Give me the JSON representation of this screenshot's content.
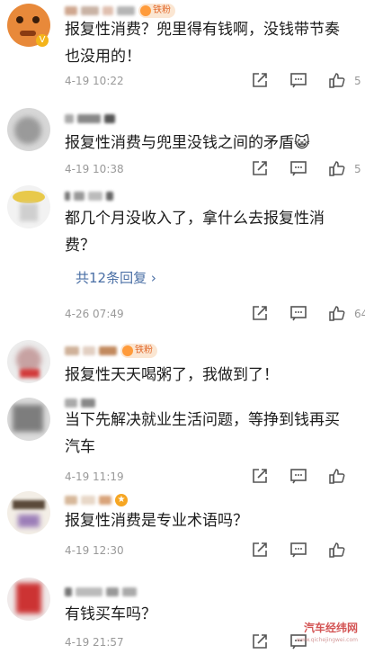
{
  "comments": [
    {
      "text": "报复性消费？兜里得有钱啊，没钱带节奏也没用的！",
      "time": "4-19 10:22",
      "likes": "5",
      "badge": "铁粉"
    },
    {
      "text": "报复性消费与兜里没钱之间的矛盾😺",
      "time": "4-19 10:38",
      "likes": "5"
    },
    {
      "text": "都几个月没收入了，拿什么去报复性消费？",
      "time": "4-26 07:49",
      "likes": "64",
      "replies": "共12条回复 ›"
    },
    {
      "text": "报复性天天喝粥了，我做到了！",
      "badge": "铁粉"
    },
    {
      "text": "当下先解决就业生活问题，等挣到钱再买汽车",
      "time": "4-19 11:19"
    },
    {
      "text": "报复性消费是专业术语吗？",
      "time": "4-19 12:30"
    },
    {
      "text": "有钱买车吗？",
      "time": "4-19 21:57"
    }
  ],
  "icons": {
    "share": "share-icon",
    "comment": "comment-icon",
    "like": "thumbs-up-icon"
  },
  "colors": {
    "text": "#1c1c1c",
    "meta": "#999999",
    "link": "#4a6fa5",
    "badge": "#e26a2c"
  },
  "watermark": {
    "main": "汽车经纬网",
    "sub": "www.qichejingwei.com"
  }
}
